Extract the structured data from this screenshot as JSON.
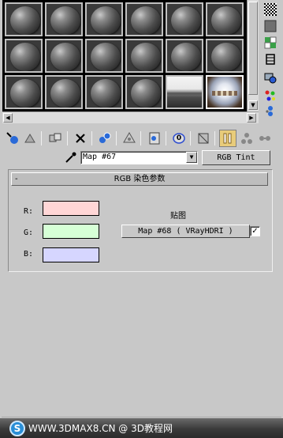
{
  "sample_slots": {
    "rows": [
      [
        "sphere",
        "sphere",
        "sphere",
        "sphere",
        "sphere",
        "sphere"
      ],
      [
        "sphere",
        "sphere",
        "sphere",
        "sphere",
        "sphere",
        "sphere"
      ],
      [
        "sphere",
        "sphere",
        "sphere",
        "sphere",
        "hdri-flat",
        "hdri-sphere"
      ]
    ],
    "active_slot": [
      2,
      5
    ]
  },
  "side_toolbar": {
    "icons": [
      "checker-background-icon",
      "gray-square-icon",
      "sample-uv-tiling-icon",
      "video-color-check-icon",
      "make-preview-icon",
      "options-icon",
      "select-by-material-icon"
    ]
  },
  "material_toolbar": {
    "icons": [
      "get-material-icon",
      "put-to-scene-icon",
      "assign-to-selection-icon",
      "reset-map-icon",
      "make-unique-icon",
      "put-to-library-icon",
      "material-effects-channel-icon",
      "show-map-in-viewport-icon",
      "show-end-result-icon",
      "go-to-parent-icon",
      "go-forward-to-sibling-icon"
    ],
    "effects_channel_value": "0"
  },
  "map_row": {
    "map_name": "Map #67",
    "map_type_button": "RGB Tint"
  },
  "rollout": {
    "toggle": "-",
    "title": "RGB 染色参数",
    "channels": [
      {
        "label": "R:",
        "color": "#ffd6d6"
      },
      {
        "label": "G:",
        "color": "#d6ffd6"
      },
      {
        "label": "B:",
        "color": "#d6d6ff"
      }
    ],
    "map_section_label": "贴图",
    "map_button": "Map #68  ( VRayHDRI )",
    "map_enabled_mark": "✓"
  },
  "footer": {
    "logo_letter": "S",
    "site_text": "WWW.3DMAX8.CN @ 3D教程网"
  }
}
